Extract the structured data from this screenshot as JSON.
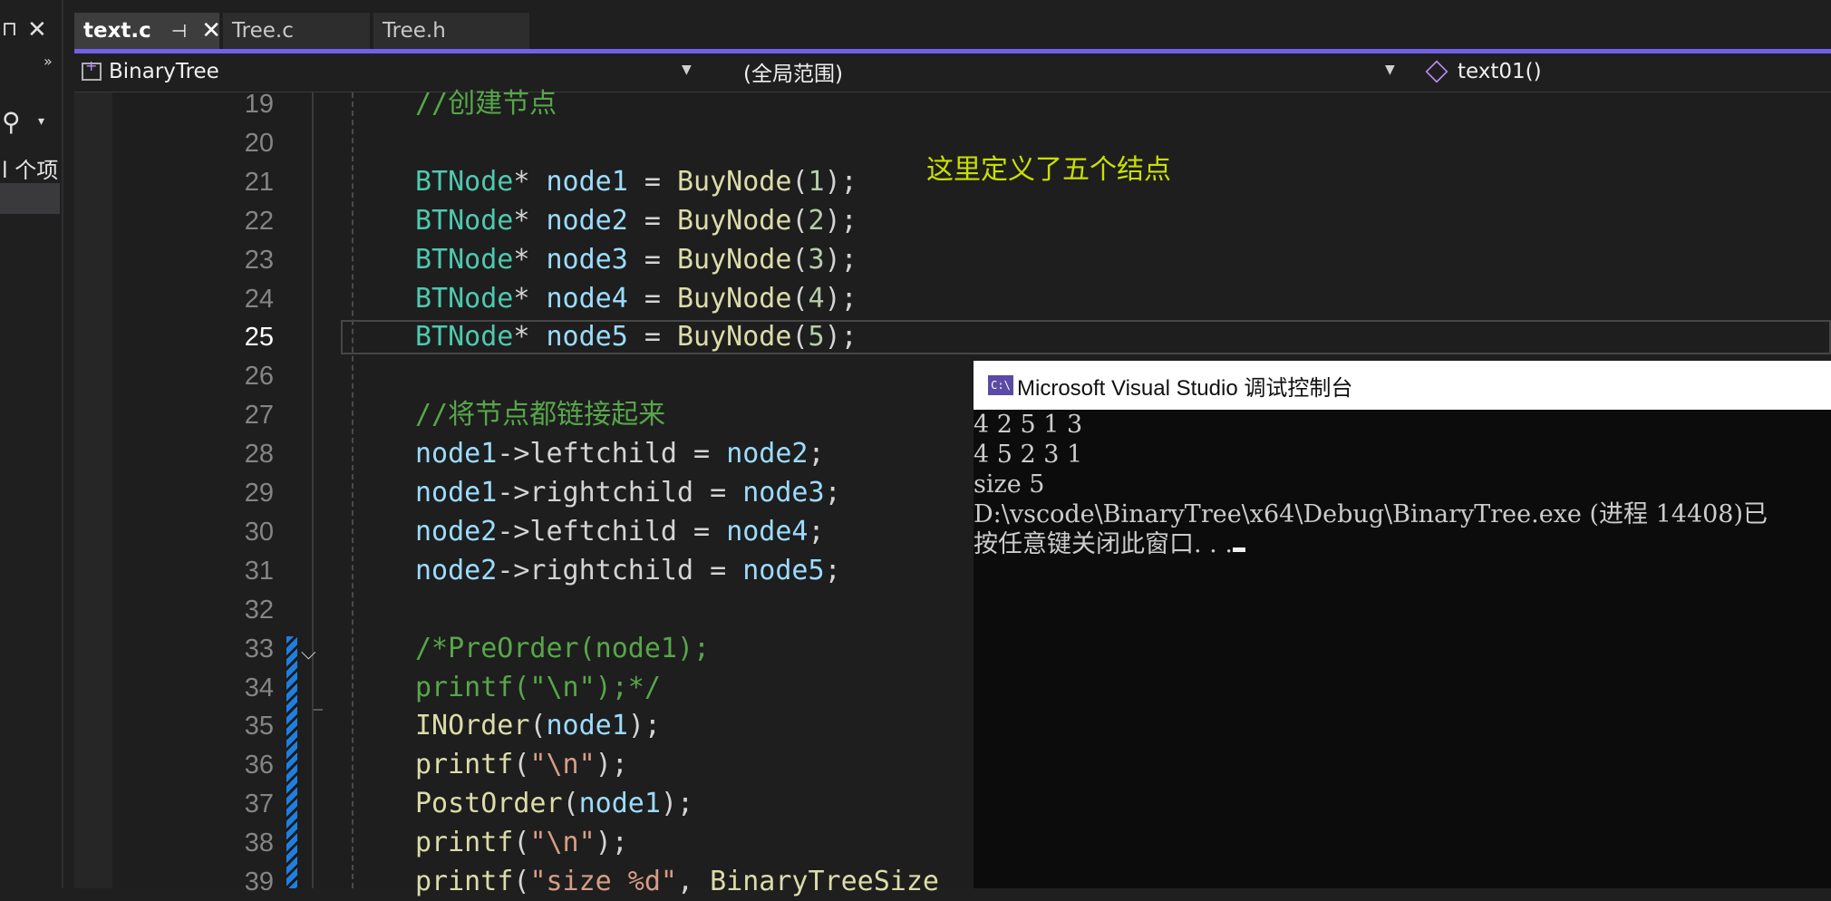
{
  "left_panel": {
    "pin_glyph": "⊓",
    "close_glyph": "✕",
    "overflow_glyph": "››",
    "search_glyph": "⚲",
    "search_caret": "▾",
    "truncated_item": "l 个项|"
  },
  "tabs": [
    {
      "label": "text.c",
      "active": true,
      "pin": "⊣",
      "close": "✕"
    },
    {
      "label": "Tree.c",
      "active": false
    },
    {
      "label": "Tree.h",
      "active": false
    }
  ],
  "accent_color": "#7160e8",
  "navbar": {
    "project": "BinaryTree",
    "scope": "(全局范围)",
    "member": "text01()",
    "caret": "▼"
  },
  "editor": {
    "current_line": "25",
    "annotation": "这里定义了五个结点",
    "lines": [
      {
        "n": "19",
        "tokens": [
          [
            "cmt",
            "//创建节点"
          ]
        ]
      },
      {
        "n": "20",
        "tokens": []
      },
      {
        "n": "21",
        "tokens": [
          [
            "type",
            "BTNode"
          ],
          [
            "op",
            "* "
          ],
          [
            "var",
            "node1"
          ],
          [
            "op",
            " = "
          ],
          [
            "fn",
            "BuyNode"
          ],
          [
            "op",
            "("
          ],
          [
            "num",
            "1"
          ],
          [
            "op",
            ");"
          ]
        ]
      },
      {
        "n": "22",
        "tokens": [
          [
            "type",
            "BTNode"
          ],
          [
            "op",
            "* "
          ],
          [
            "var",
            "node2"
          ],
          [
            "op",
            " = "
          ],
          [
            "fn",
            "BuyNode"
          ],
          [
            "op",
            "("
          ],
          [
            "num",
            "2"
          ],
          [
            "op",
            ");"
          ]
        ]
      },
      {
        "n": "23",
        "tokens": [
          [
            "type",
            "BTNode"
          ],
          [
            "op",
            "* "
          ],
          [
            "var",
            "node3"
          ],
          [
            "op",
            " = "
          ],
          [
            "fn",
            "BuyNode"
          ],
          [
            "op",
            "("
          ],
          [
            "num",
            "3"
          ],
          [
            "op",
            ");"
          ]
        ]
      },
      {
        "n": "24",
        "tokens": [
          [
            "type",
            "BTNode"
          ],
          [
            "op",
            "* "
          ],
          [
            "var",
            "node4"
          ],
          [
            "op",
            " = "
          ],
          [
            "fn",
            "BuyNode"
          ],
          [
            "op",
            "("
          ],
          [
            "num",
            "4"
          ],
          [
            "op",
            ");"
          ]
        ]
      },
      {
        "n": "25",
        "tokens": [
          [
            "type",
            "BTNode"
          ],
          [
            "op",
            "* "
          ],
          [
            "var",
            "node5"
          ],
          [
            "op",
            " = "
          ],
          [
            "fn",
            "BuyNode"
          ],
          [
            "op",
            "("
          ],
          [
            "num",
            "5"
          ],
          [
            "op",
            ");"
          ]
        ]
      },
      {
        "n": "26",
        "tokens": []
      },
      {
        "n": "27",
        "tokens": [
          [
            "cmt",
            "//将节点都链接起来"
          ]
        ]
      },
      {
        "n": "28",
        "tokens": [
          [
            "var",
            "node1"
          ],
          [
            "op",
            "->leftchild = "
          ],
          [
            "var",
            "node2"
          ],
          [
            "op",
            ";"
          ]
        ]
      },
      {
        "n": "29",
        "tokens": [
          [
            "var",
            "node1"
          ],
          [
            "op",
            "->rightchild = "
          ],
          [
            "var",
            "node3"
          ],
          [
            "op",
            ";"
          ]
        ]
      },
      {
        "n": "30",
        "tokens": [
          [
            "var",
            "node2"
          ],
          [
            "op",
            "->leftchild = "
          ],
          [
            "var",
            "node4"
          ],
          [
            "op",
            ";"
          ]
        ]
      },
      {
        "n": "31",
        "tokens": [
          [
            "var",
            "node2"
          ],
          [
            "op",
            "->rightchild = "
          ],
          [
            "var",
            "node5"
          ],
          [
            "op",
            ";"
          ]
        ]
      },
      {
        "n": "32",
        "tokens": []
      },
      {
        "n": "33",
        "tokens": [
          [
            "cmt",
            "/*PreOrder(node1);"
          ]
        ]
      },
      {
        "n": "34",
        "tokens": [
          [
            "cmt",
            "printf(\"\\n\");*/"
          ]
        ]
      },
      {
        "n": "35",
        "tokens": [
          [
            "fn",
            "INOrder"
          ],
          [
            "op",
            "("
          ],
          [
            "var",
            "node1"
          ],
          [
            "op",
            ");"
          ]
        ]
      },
      {
        "n": "36",
        "tokens": [
          [
            "fn",
            "printf"
          ],
          [
            "op",
            "("
          ],
          [
            "str",
            "\"\\n\""
          ],
          [
            "op",
            ");"
          ]
        ]
      },
      {
        "n": "37",
        "tokens": [
          [
            "fn",
            "PostOrder"
          ],
          [
            "op",
            "("
          ],
          [
            "var",
            "node1"
          ],
          [
            "op",
            ");"
          ]
        ]
      },
      {
        "n": "38",
        "tokens": [
          [
            "fn",
            "printf"
          ],
          [
            "op",
            "("
          ],
          [
            "str",
            "\"\\n\""
          ],
          [
            "op",
            ");"
          ]
        ]
      },
      {
        "n": "39",
        "tokens": [
          [
            "fn",
            "printf"
          ],
          [
            "op",
            "("
          ],
          [
            "str",
            "\"size %d\""
          ],
          [
            "op",
            ", "
          ],
          [
            "fn",
            "BinaryTreeSize"
          ]
        ]
      }
    ]
  },
  "console": {
    "icon_text": "C:\\",
    "title": "Microsoft Visual Studio 调试控制台",
    "lines": [
      "4 2 5 1 3",
      "4 5 2 3 1",
      "size 5",
      "D:\\vscode\\BinaryTree\\x64\\Debug\\BinaryTree.exe (进程 14408)已",
      "按任意键关闭此窗口. . ."
    ]
  }
}
